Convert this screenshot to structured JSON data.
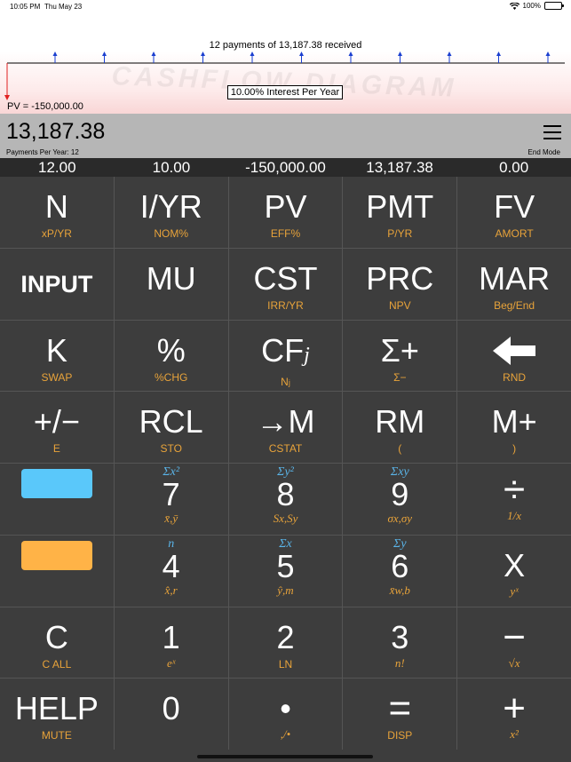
{
  "status_bar": {
    "time": "10:05 PM",
    "date": "Thu May 23",
    "battery": "100%"
  },
  "diagram": {
    "summary": "12 payments of 13,187.38 received",
    "watermark": "CASHFLOW DIAGRAM",
    "interest": "10.00% Interest Per Year",
    "pv": "PV = -150,000.00",
    "payment_count": 12
  },
  "display": {
    "value": "13,187.38",
    "payments_per_year": "Payments Per Year: 12",
    "mode": "End Mode"
  },
  "registers": [
    "12.00",
    "10.00",
    "-150,000.00",
    "13,187.38",
    "0.00"
  ],
  "colors": {
    "blue_key": "#5ac8fa",
    "orange_key": "#ffb347",
    "accent": "#e8a33a",
    "stat": "#5ab4e8"
  },
  "keys": {
    "n": {
      "main": "N",
      "sub": "xP/YR"
    },
    "iyr": {
      "main": "I/YR",
      "sub": "NOM%"
    },
    "pv": {
      "main": "PV",
      "sub": "EFF%"
    },
    "pmt": {
      "main": "PMT",
      "sub": "P/YR"
    },
    "fv": {
      "main": "FV",
      "sub": "AMORT"
    },
    "input": {
      "main": "INPUT",
      "sub": ""
    },
    "mu": {
      "main": "MU",
      "sub": ""
    },
    "cst": {
      "main": "CST",
      "sub": "IRR/YR"
    },
    "prc": {
      "main": "PRC",
      "sub": "NPV"
    },
    "mar": {
      "main": "MAR",
      "sub": "Beg/End"
    },
    "k": {
      "main": "K",
      "sub": "SWAP"
    },
    "pct": {
      "main": "%",
      "sub": "%CHG"
    },
    "cfj": {
      "main": "CF",
      "main_sub": "j",
      "sub": "N",
      "sub_sub": "j"
    },
    "sigma_plus": {
      "main": "Σ+",
      "sub": "Σ−"
    },
    "backspace": {
      "icon": "left-arrow-icon",
      "sub": "RND"
    },
    "plusminus": {
      "main": "+/−",
      "sub": "E"
    },
    "rcl": {
      "main": "RCL",
      "sub": "STO"
    },
    "to_m": {
      "main": "→M",
      "sub": "CSTAT"
    },
    "rm": {
      "main": "RM",
      "sub": "("
    },
    "m_plus": {
      "main": "M+",
      "sub": ")"
    },
    "seven": {
      "top": "Σx²",
      "main": "7",
      "sub": "x̄,ȳ"
    },
    "eight": {
      "top": "Σy²",
      "main": "8",
      "sub": "Sx,Sy"
    },
    "nine": {
      "top": "Σxy",
      "main": "9",
      "sub": "σx,σy"
    },
    "divide": {
      "main": "÷",
      "sub": "1/x"
    },
    "four": {
      "top": "n",
      "main": "4",
      "sub": "x̂,r"
    },
    "five": {
      "top": "Σx",
      "main": "5",
      "sub": "ŷ,m"
    },
    "six": {
      "top": "Σy",
      "main": "6",
      "sub": "x̄w,b"
    },
    "multiply": {
      "main": "X",
      "sub": "yˣ"
    },
    "clear": {
      "main": "C",
      "sub": "C ALL"
    },
    "one": {
      "main": "1",
      "sub": "eˣ"
    },
    "two": {
      "main": "2",
      "sub": "LN"
    },
    "three": {
      "main": "3",
      "sub": "n!"
    },
    "minus": {
      "main": "−",
      "sub": "√x"
    },
    "help": {
      "main": "HELP",
      "sub": "MUTE"
    },
    "zero": {
      "main": "0",
      "sub": ""
    },
    "dot": {
      "main": "•",
      "sub": ",/•"
    },
    "equals": {
      "main": "=",
      "sub": "DISP"
    },
    "plus": {
      "main": "+",
      "sub": "x²"
    }
  }
}
